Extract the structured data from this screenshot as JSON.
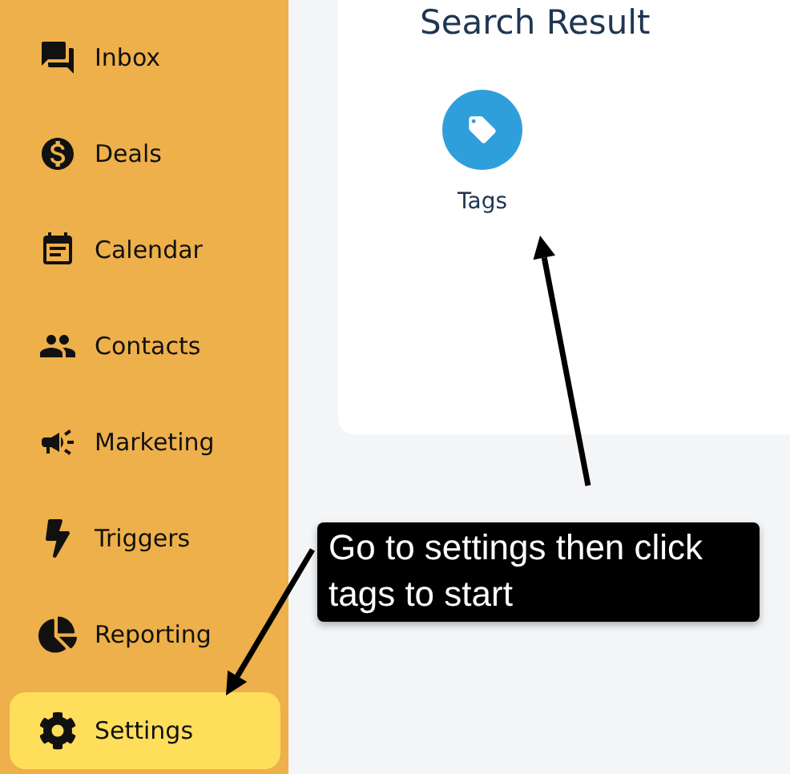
{
  "sidebar": {
    "items": [
      {
        "label": "Inbox",
        "selected": false
      },
      {
        "label": "Deals",
        "selected": false
      },
      {
        "label": "Calendar",
        "selected": false
      },
      {
        "label": "Contacts",
        "selected": false
      },
      {
        "label": "Marketing",
        "selected": false
      },
      {
        "label": "Triggers",
        "selected": false
      },
      {
        "label": "Reporting",
        "selected": false
      },
      {
        "label": "Settings",
        "selected": true
      }
    ]
  },
  "search_result": {
    "title": "Search Result",
    "results": [
      {
        "label": "Tags"
      }
    ]
  },
  "callout": {
    "text": "Go to settings then click tags to start"
  }
}
